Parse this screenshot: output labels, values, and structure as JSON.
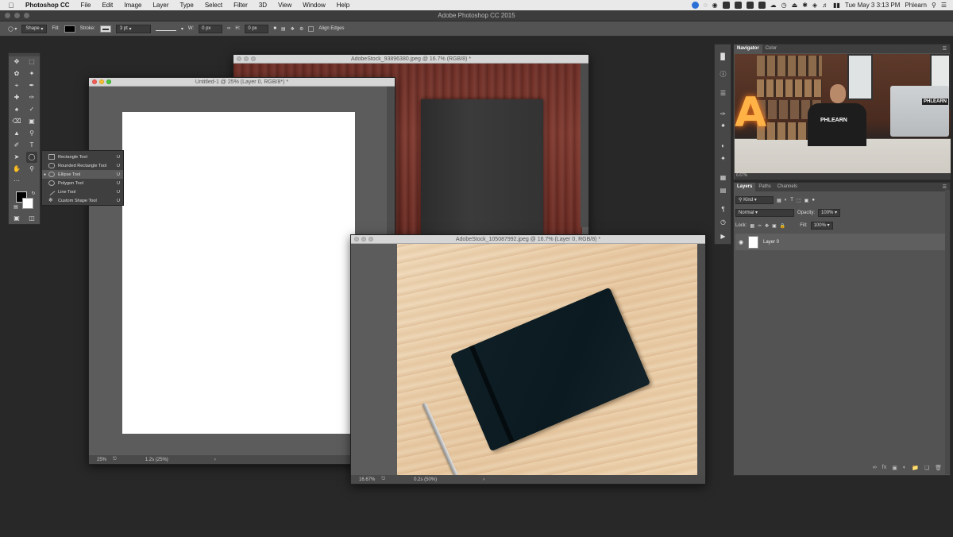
{
  "menubar": {
    "app_name": "Photoshop CC",
    "menus": [
      "File",
      "Edit",
      "Image",
      "Layer",
      "Type",
      "Select",
      "Filter",
      "3D",
      "View",
      "Window",
      "Help"
    ],
    "clock": "Tue May 3  3:13 PM",
    "user": "Phlearn"
  },
  "app_title": "Adobe Photoshop CC 2015",
  "options": {
    "mode": "Shape",
    "fill_label": "Fill:",
    "stroke_label": "Stroke:",
    "stroke_size": "3 pt",
    "w_label": "W:",
    "w_value": "0 px",
    "h_label": "H:",
    "h_value": "0 px",
    "align_edges": "Align Edges"
  },
  "flyout": {
    "items": [
      {
        "label": "Rectangle Tool",
        "key": "U"
      },
      {
        "label": "Rounded Rectangle Tool",
        "key": "U"
      },
      {
        "label": "Ellipse Tool",
        "key": "U"
      },
      {
        "label": "Polygon Tool",
        "key": "U"
      },
      {
        "label": "Line Tool",
        "key": "U"
      },
      {
        "label": "Custom Shape Tool",
        "key": "U"
      }
    ],
    "selected_index": 2
  },
  "docs": {
    "doc1": {
      "title": "Untitled-1 @ 25% (Layer 0, RGB/8*) *",
      "zoom": "25%",
      "info": "1.2s (25%)"
    },
    "doc2": {
      "title": "AdobeStock_93896380.jpeg @ 16.7% (RGB/8) *"
    },
    "doc3": {
      "title": "AdobeStock_105087992.jpeg @ 16.7% (Layer 0, RGB/8) *",
      "zoom": "16.67%",
      "info": "0.2s (50%)"
    }
  },
  "navigator": {
    "tabs": [
      "Navigator",
      "Color"
    ],
    "shirt_text": "PHLEARN",
    "monitor_text": "PHLEARN",
    "sign_letter": "A",
    "zoom_readout": "6.67%"
  },
  "layers": {
    "tabs": [
      "Layers",
      "Paths",
      "Channels"
    ],
    "kind": "Kind",
    "blend": "Normal",
    "opacity_label": "Opacity:",
    "opacity": "100%",
    "lock_label": "Lock:",
    "fill_label": "Fill:",
    "fill": "100%",
    "layer_name": "Layer 0"
  }
}
